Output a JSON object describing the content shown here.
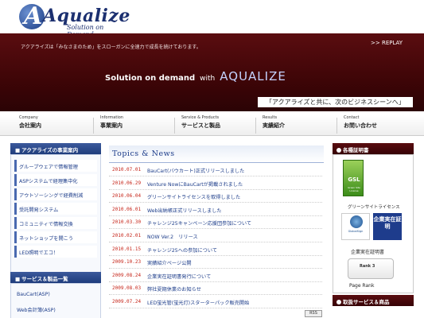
{
  "header": {
    "logo_tagline": "Solution on Demand",
    "logo_text": "Aqualize"
  },
  "banner": {
    "slogan": "アクアライズは「みなさまのため」をスローガンに全速力で成長を続けております。",
    "replay": ">> REPLAY",
    "hero_main": "Solution on demand",
    "hero_with": "with",
    "hero_brand": "AQUALIZE",
    "catch": "「アクアライズと共に、次のビジネスシーンへ」"
  },
  "nav": [
    {
      "en": "Company",
      "ja": "会社案内"
    },
    {
      "en": "Information",
      "ja": "事業案内"
    },
    {
      "en": "Service & Products",
      "ja": "サービスと製品"
    },
    {
      "en": "Results",
      "ja": "実績紹介"
    },
    {
      "en": "Contact",
      "ja": "お問い合わせ"
    }
  ],
  "left": {
    "box1_title": "アクアライズの事業案内",
    "box1_items": [
      "グループウェアで情報管理",
      "ASPシステムで経理集中化",
      "アウトソーシングで経費削減",
      "受託開発システム",
      "コミュニティで情報交換",
      "ネットショップを開こう",
      "LED照明でエコ！"
    ],
    "box2_title": "サービス＆製品一覧",
    "box2_items": [
      "BauCart(ASP)",
      "Web会計簿(ASP)"
    ]
  },
  "topics": {
    "title": "Topics & News",
    "items": [
      {
        "date": "2010.07.01",
        "text": "BauCart(バウカート)正式リリースしました"
      },
      {
        "date": "2010.06.29",
        "text": "Venture NowにBauCartが掲載されました"
      },
      {
        "date": "2010.06.04",
        "text": "グリーンサイトライセンスを取得しました"
      },
      {
        "date": "2010.06.01",
        "text": "Web出納帳正式リリースしました"
      },
      {
        "date": "2010.03.30",
        "text": "チャレンジ25キャンペーン応援団参加について"
      },
      {
        "date": "2010.02.01",
        "text": "NOW Ver.2　リリース"
      },
      {
        "date": "2010.01.15",
        "text": "チャレンジ25への参加について"
      },
      {
        "date": "2009.10.23",
        "text": "実績紹介ページ公開"
      },
      {
        "date": "2009.08.24",
        "text": "企業実在証明書発行について"
      },
      {
        "date": "2009.08.03",
        "text": "弊社夏期休業のお知らせ"
      },
      {
        "date": "2009.07.24",
        "text": "LED蛍光管(蛍光灯)スターターパック販売開始"
      }
    ],
    "rss": "RSS"
  },
  "right": {
    "title": "各種証明書",
    "gsl": "GSL",
    "gsl_sub": "Green Site License",
    "greensite": "グリーンサイトライセンス",
    "globalsign": "GlobalSign",
    "kigyou": "企業実在証明",
    "certs_label": "企業実在証明書",
    "rank": "Rank 3",
    "pagerank": "Page Rank",
    "title2": "取扱サービス＆商品"
  }
}
